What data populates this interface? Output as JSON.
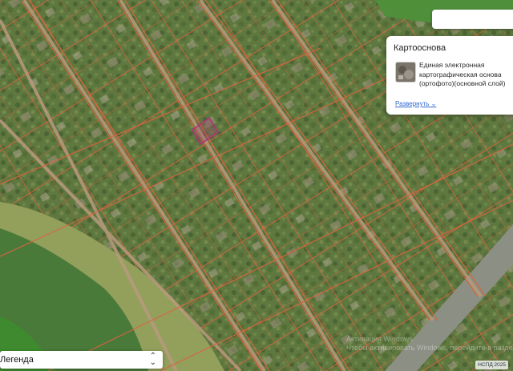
{
  "layers_panel": {
    "title": "Картооснова",
    "layer_name": "Единая электронная картографическая основа (ортофото)(основной слой)",
    "expand_label": "Развернуть"
  },
  "legend": {
    "label": "Легенда"
  },
  "attribution": "НСПД 2025",
  "watermark": {
    "line1": "Активация Windows",
    "line2": "Чтобы активировать Windows, перейдите в раздел \"Параметры\"."
  },
  "colors": {
    "parcel_lines": "#d9643f",
    "selected_parcel": "#b3307d",
    "link": "#2f66d0"
  },
  "icons": {
    "expand": "chevron-down-icon",
    "legend_select": "updown-arrows-icon"
  }
}
